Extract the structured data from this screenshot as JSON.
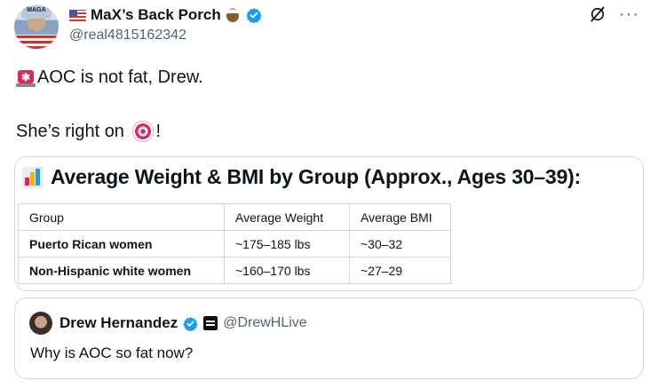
{
  "author": {
    "avatar_badge_text": "MAGA",
    "display_name": "MaX’s Back Porch",
    "handle": "@real4815162342",
    "verified": true,
    "icons": [
      "us-flag-icon",
      "coffee-icon",
      "verified-badge-icon"
    ]
  },
  "header_actions": {
    "icons": [
      "grok-icon",
      "more-icon"
    ],
    "more_label": "···"
  },
  "tweet": {
    "line1": "AOC is not fat, Drew.",
    "line2_before": "She’s right on ",
    "line2_after": "!",
    "emojis": [
      "siren-icon",
      "direct-hit-icon"
    ]
  },
  "card": {
    "title": "Average Weight & BMI by Group (Approx., Ages 30–39):",
    "icon": "bar-chart-icon",
    "table": {
      "headers": [
        "Group",
        "Average Weight",
        "Average BMI"
      ],
      "rows": [
        [
          "Puerto Rican women",
          "~175–185 lbs",
          "~30–32"
        ],
        [
          "Non-Hispanic white women",
          "~160–170 lbs",
          "~27–29"
        ]
      ]
    }
  },
  "quoted_tweet": {
    "display_name": "Drew Hernandez",
    "handle": "@DrewHLive",
    "verified": true,
    "text": "Why is AOC so fat now?"
  },
  "colors": {
    "text": "#0f1419",
    "secondary": "#536471",
    "border": "#cfd9de",
    "verified": "#1d9bf0"
  }
}
